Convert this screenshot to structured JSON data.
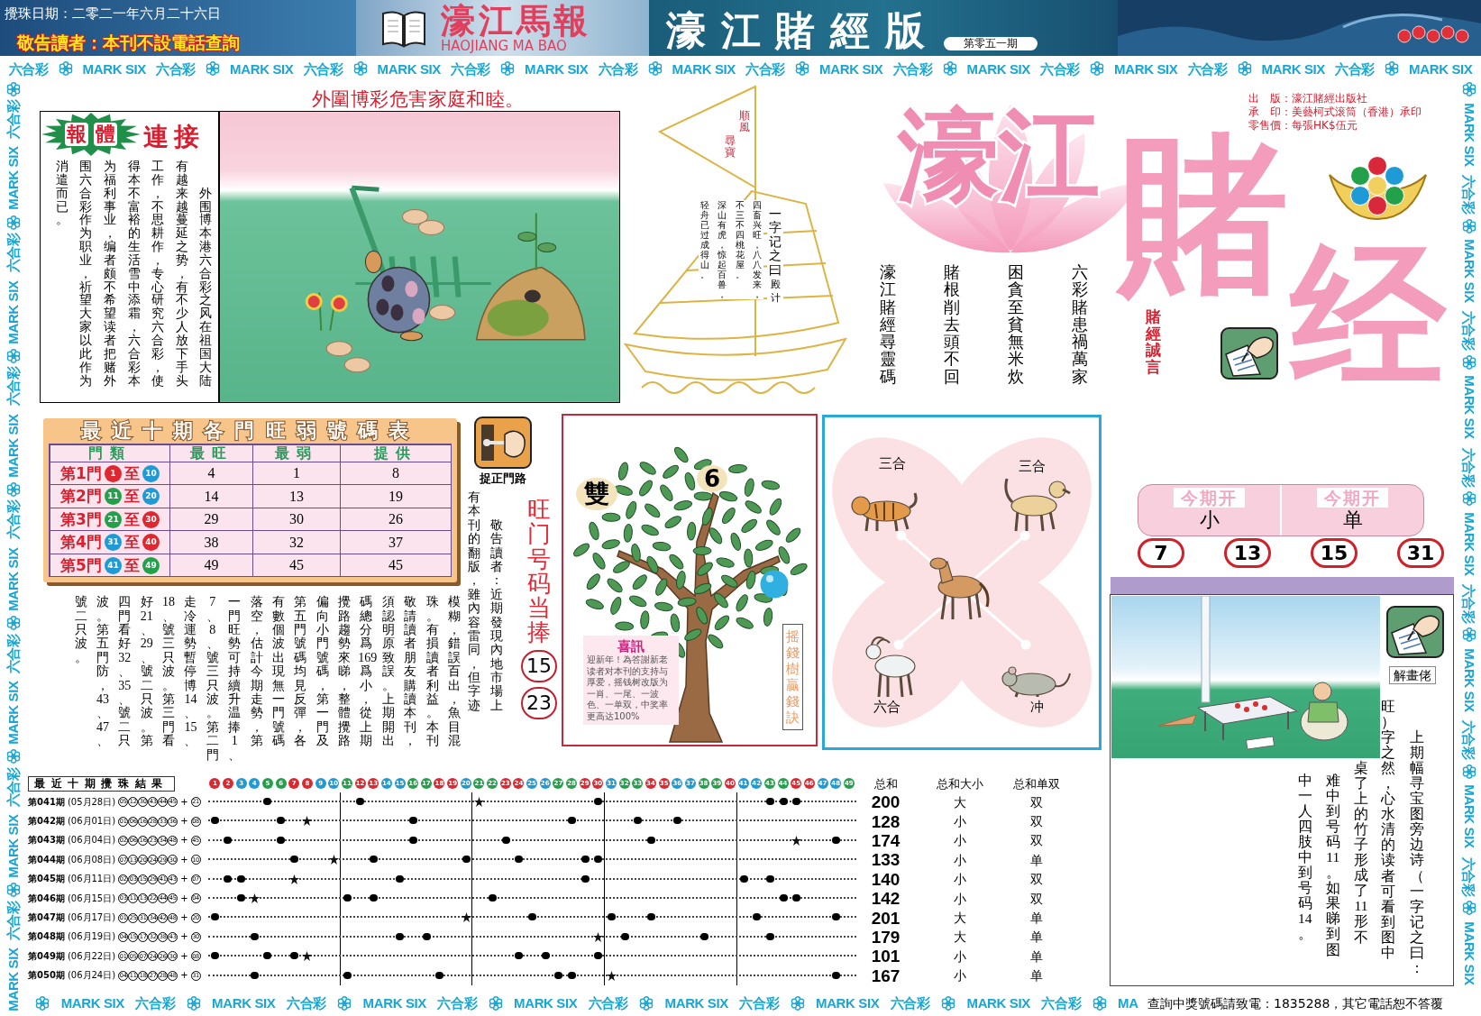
{
  "header": {
    "draw_date": "攪珠日期：二零二一年六月二十六日",
    "notice": "敬告讀者：本刊不設電話查詢",
    "masthead": "濠江馬報",
    "masthead_latin": "HAOJIANG MA BAO",
    "edition": "濠江賭經版",
    "issue": "第零五一期"
  },
  "border": {
    "top": [
      "六合彩",
      "MARK SIX",
      "六合彩",
      "MARK SIX",
      "六合彩",
      "MARK SIX",
      "六合彩",
      "MARK SIX",
      "六合彩",
      "MARK SIX",
      "六合彩",
      "MARK SIX",
      "六合彩",
      "MARK SIX",
      "六合彩",
      "MARK SIX",
      "六合彩",
      "MARK SIX",
      "六合彩",
      "MARK SIX"
    ],
    "left": [
      "六合彩",
      "MARK SIX",
      "六合彩",
      "MARK SIX",
      "六合彩",
      "MARK SIX",
      "六合彩",
      "MARK SIX",
      "六合彩",
      "MARK SIX",
      "六合彩",
      "MARK SIX",
      "六合彩",
      "MARK SIX"
    ],
    "right": [
      "MARK SIX",
      "六合彩",
      "MARK SIX",
      "六合彩",
      "MARK SIX",
      "六合彩",
      "MARK SIX",
      "六合彩",
      "MARK SIX",
      "六合彩",
      "MARK SIX",
      "六合彩",
      "MARK SIX"
    ],
    "bottom": [
      "MARK SIX",
      "六合彩",
      "MARK SIX",
      "六合彩",
      "MARK SIX",
      "六合彩",
      "MARK SIX",
      "六合彩",
      "MARK SIX",
      "六合彩",
      "MARK SIX",
      "六合彩",
      "MARK SIX",
      "六合彩",
      "MA"
    ]
  },
  "headline": "外圍博彩危害家庭和睦。",
  "feature": {
    "badge": "報體",
    "title": "連接",
    "text": "外围博本港六合彩之风在祖国大陆有越来越蔓延之势，有不少人放下手头工作，不思耕作，专心研究六合彩，使得本不富裕的生活雪中添霜，六合彩本为福利事业，编者颇不希望读者把赌外围六合彩作为职业，祈望大家以此作为消遣而已。"
  },
  "sailboat": {
    "flag": "順風尋寶",
    "heading": "一字记之曰",
    "answer": "殿计",
    "poem": "四畜兴旺，八八发来，不三不四桃花屋。深山有虎，惊起百兽，轻舟已过成得山。"
  },
  "logo": {
    "lotus_title": "濠江",
    "big_characters": [
      "賭",
      "经"
    ],
    "publisher": [
      "出　版：濠江賭經出版社",
      "承　印：美藝柯式滚筒（香港）承印",
      "零售價：每張HK$伍元"
    ],
    "motto": "賭經誠言",
    "verse": "六彩賭患禍萬家困貪至貧無米炊賭根削去頭不回濠江賭經尋靈碼"
  },
  "door_table": {
    "title": "最近十期各門旺弱號碼表",
    "door_column": "門類",
    "columns": [
      "最旺",
      "最弱",
      "提供"
    ],
    "rows": [
      {
        "door": "第1門",
        "from": {
          "label": "1",
          "color": "#e0262e"
        },
        "link": "至",
        "to": {
          "label": "10",
          "color": "#1e9ad6"
        },
        "cells": [
          "4",
          "1",
          "8"
        ]
      },
      {
        "door": "第2門",
        "from": {
          "label": "11",
          "color": "#23a04a"
        },
        "link": "至",
        "to": {
          "label": "20",
          "color": "#1e9ad6"
        },
        "cells": [
          "14",
          "13",
          "19"
        ]
      },
      {
        "door": "第3門",
        "from": {
          "label": "21",
          "color": "#23a04a"
        },
        "link": "至",
        "to": {
          "label": "30",
          "color": "#e0262e"
        },
        "cells": [
          "29",
          "30",
          "26"
        ]
      },
      {
        "door": "第4門",
        "from": {
          "label": "31",
          "color": "#1e9ad6"
        },
        "link": "至",
        "to": {
          "label": "40",
          "color": "#e0262e"
        },
        "cells": [
          "38",
          "32",
          "37"
        ]
      },
      {
        "door": "第5門",
        "from": {
          "label": "41",
          "color": "#1e9ad6"
        },
        "link": "至",
        "to": {
          "label": "49",
          "color": "#23a04a"
        },
        "cells": [
          "49",
          "45",
          "45"
        ]
      }
    ]
  },
  "door_tip": {
    "label": "捉正門路",
    "text_beside_icon": "敬告讀者：近期發現內地市場上有本刊的翻版，雖內容雷同，但字迹",
    "text_below_table": "模糊，錯誤百出，魚目混珠。有損讀者利益。本刊敬請讀者朋友購讀本刊，須認明原致誤。上期開出碼總分爲169爲小，從上期攪路趨勢來睇，整體攪路偏向小門號碼，第一門及第五門號碼均見反彈，各有數個波出現無一門號碼落空，估計今期走勢，第一門旺勢可持續升温捧1、7、8、號三只波。第二門走冷運勢暫停博14、15、18、號三只波。第三門看好21、29、號二只波。第四門看好32、35、號二只波。第五門防，43、47、號二只波。"
  },
  "hot_numbers": {
    "title": "旺门号码当捧",
    "numbers": [
      "15",
      "23"
    ]
  },
  "money_tree": {
    "leaves": [
      "雙",
      "6"
    ],
    "news_title": "喜訊",
    "news_text": "迎新年！為答謝新老读者对本刊的支持与厚爱，摇钱树改版为一肖、一尾、一波色、一单双，中奖率更高达100%",
    "caption": "摇錢樹贏錢訣"
  },
  "zodiac": {
    "labels": [
      "三合",
      "三合",
      "六合",
      "冲"
    ]
  },
  "this_issue": {
    "tags": [
      {
        "heading": "今期开",
        "value": "小"
      },
      {
        "heading": "今期开",
        "value": "单"
      }
    ],
    "numbers": [
      "7",
      "13",
      "15",
      "31"
    ]
  },
  "cartoon": {
    "label": "解畫佬",
    "text_beside_icon": "上期幅寻宝图旁边诗（一字记之曰：旺）字之然，心水清的读者可看到图中",
    "text_below_picture": "桌了上的竹子形成了11形不难中到号码11。如果睇到图中一人四肢中到号码14。"
  },
  "results": {
    "title": "最近十期攪珠結果",
    "balls": [
      {
        "label": "1",
        "color": "#e0262e"
      },
      {
        "label": "2",
        "color": "#e0262e"
      },
      {
        "label": "3",
        "color": "#1e9ad6"
      },
      {
        "label": "4",
        "color": "#1e9ad6"
      },
      {
        "label": "5",
        "color": "#23a04a"
      },
      {
        "label": "6",
        "color": "#23a04a"
      },
      {
        "label": "7",
        "color": "#e0262e"
      },
      {
        "label": "8",
        "color": "#e0262e"
      },
      {
        "label": "9",
        "color": "#1e9ad6"
      },
      {
        "label": "10",
        "color": "#1e9ad6"
      },
      {
        "label": "11",
        "color": "#23a04a"
      },
      {
        "label": "12",
        "color": "#e0262e"
      },
      {
        "label": "13",
        "color": "#e0262e"
      },
      {
        "label": "14",
        "color": "#1e9ad6"
      },
      {
        "label": "15",
        "color": "#1e9ad6"
      },
      {
        "label": "16",
        "color": "#23a04a"
      },
      {
        "label": "17",
        "color": "#23a04a"
      },
      {
        "label": "18",
        "color": "#e0262e"
      },
      {
        "label": "19",
        "color": "#e0262e"
      },
      {
        "label": "20",
        "color": "#1e9ad6"
      },
      {
        "label": "21",
        "color": "#23a04a"
      },
      {
        "label": "22",
        "color": "#23a04a"
      },
      {
        "label": "23",
        "color": "#e0262e"
      },
      {
        "label": "24",
        "color": "#e0262e"
      },
      {
        "label": "25",
        "color": "#1e9ad6"
      },
      {
        "label": "26",
        "color": "#1e9ad6"
      },
      {
        "label": "27",
        "color": "#23a04a"
      },
      {
        "label": "28",
        "color": "#23a04a"
      },
      {
        "label": "29",
        "color": "#e0262e"
      },
      {
        "label": "30",
        "color": "#e0262e"
      },
      {
        "label": "31",
        "color": "#1e9ad6"
      },
      {
        "label": "32",
        "color": "#23a04a"
      },
      {
        "label": "33",
        "color": "#23a04a"
      },
      {
        "label": "34",
        "color": "#e0262e"
      },
      {
        "label": "35",
        "color": "#e0262e"
      },
      {
        "label": "36",
        "color": "#1e9ad6"
      },
      {
        "label": "37",
        "color": "#1e9ad6"
      },
      {
        "label": "38",
        "color": "#23a04a"
      },
      {
        "label": "39",
        "color": "#23a04a"
      },
      {
        "label": "40",
        "color": "#e0262e"
      },
      {
        "label": "41",
        "color": "#1e9ad6"
      },
      {
        "label": "42",
        "color": "#1e9ad6"
      },
      {
        "label": "43",
        "color": "#23a04a"
      },
      {
        "label": "44",
        "color": "#23a04a"
      },
      {
        "label": "45",
        "color": "#e0262e"
      },
      {
        "label": "46",
        "color": "#e0262e"
      },
      {
        "label": "47",
        "color": "#1e9ad6"
      },
      {
        "label": "48",
        "color": "#1e9ad6"
      },
      {
        "label": "49",
        "color": "#23a04a"
      }
    ],
    "headers": [
      "总和",
      "总和大小",
      "总和单双"
    ],
    "rows": [
      {
        "period": "第041期",
        "date": "(05月28日)",
        "numbers": [
          "05",
          "12",
          "30",
          "43",
          "44",
          "45"
        ],
        "joiner": "+",
        "special": "21",
        "sum": "200",
        "size": "大",
        "parity": "双"
      },
      {
        "period": "第042期",
        "date": "(06月01日)",
        "numbers": [
          "01",
          "06",
          "16",
          "28",
          "33",
          "36"
        ],
        "joiner": "+",
        "special": "08",
        "sum": "128",
        "size": "小",
        "parity": "双"
      },
      {
        "period": "第043期",
        "date": "(06月04日)",
        "numbers": [
          "02",
          "06",
          "16",
          "23",
          "34",
          "48"
        ],
        "joiner": "+",
        "special": "45",
        "sum": "174",
        "size": "小",
        "parity": "双"
      },
      {
        "period": "第044期",
        "date": "(06月08日)",
        "numbers": [
          "07",
          "13",
          "20",
          "24",
          "29",
          "30"
        ],
        "joiner": "+",
        "special": "10",
        "sum": "133",
        "size": "小",
        "parity": "单"
      },
      {
        "period": "第045期",
        "date": "(06月11日)",
        "numbers": [
          "02",
          "03",
          "15",
          "29",
          "41",
          "43"
        ],
        "joiner": "+",
        "special": "07",
        "sum": "140",
        "size": "小",
        "parity": "双"
      },
      {
        "period": "第046期",
        "date": "(06月15日)",
        "numbers": [
          "03",
          "11",
          "13",
          "22",
          "44",
          "45"
        ],
        "joiner": "+",
        "special": "04",
        "sum": "142",
        "size": "小",
        "parity": "双"
      },
      {
        "period": "第047期",
        "date": "(06月17日)",
        "numbers": [
          "01",
          "25",
          "31",
          "34",
          "42",
          "48"
        ],
        "joiner": "+",
        "special": "20",
        "sum": "201",
        "size": "大",
        "parity": "单"
      },
      {
        "period": "第048期",
        "date": "(06月19日)",
        "numbers": [
          "04",
          "15",
          "17",
          "32",
          "38",
          "43"
        ],
        "joiner": "+",
        "special": "30",
        "sum": "179",
        "size": "大",
        "parity": "单"
      },
      {
        "period": "第049期",
        "date": "(06月22日)",
        "numbers": [
          "01",
          "05",
          "07",
          "24",
          "26",
          "30"
        ],
        "joiner": "+",
        "special": "08",
        "sum": "101",
        "size": "小",
        "parity": "单"
      },
      {
        "period": "第050期",
        "date": "(06月24日)",
        "numbers": [
          "04",
          "11",
          "18",
          "27",
          "28",
          "48"
        ],
        "joiner": "+",
        "special": "31",
        "sum": "167",
        "size": "小",
        "parity": "单"
      }
    ]
  },
  "footer_notice": "查詢中獎號碼請致電：1835288，其它電話恕不答覆"
}
